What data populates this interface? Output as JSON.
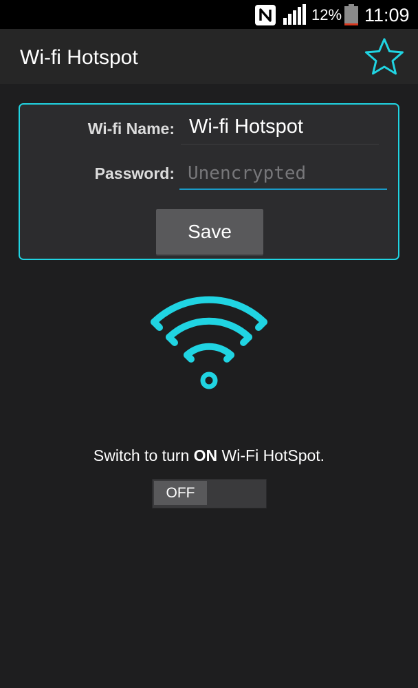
{
  "status_bar": {
    "battery_percent": "12%",
    "time": "11:09",
    "icons": [
      "nfc-icon",
      "signal-icon",
      "battery-icon"
    ],
    "battery_level": 0.12,
    "battery_color": "#d9381e"
  },
  "app_bar": {
    "title": "Wi-fi Hotspot",
    "favorite_icon": "star-outline-icon"
  },
  "form": {
    "name_label": "Wi-fi Name:",
    "name_value": "Wi-fi Hotspot",
    "password_label": "Password:",
    "password_value": "",
    "password_placeholder": "Unencrypted",
    "save_label": "Save"
  },
  "hotspot": {
    "icon": "wifi-icon",
    "hint_prefix": "Switch to turn ",
    "hint_emphasis": "ON",
    "hint_suffix": " Wi-Fi HotSpot.",
    "toggle_label": "OFF"
  },
  "colors": {
    "accent": "#20d4e2",
    "background": "#1e1e1f",
    "input_underline": "#1a9bc8"
  }
}
